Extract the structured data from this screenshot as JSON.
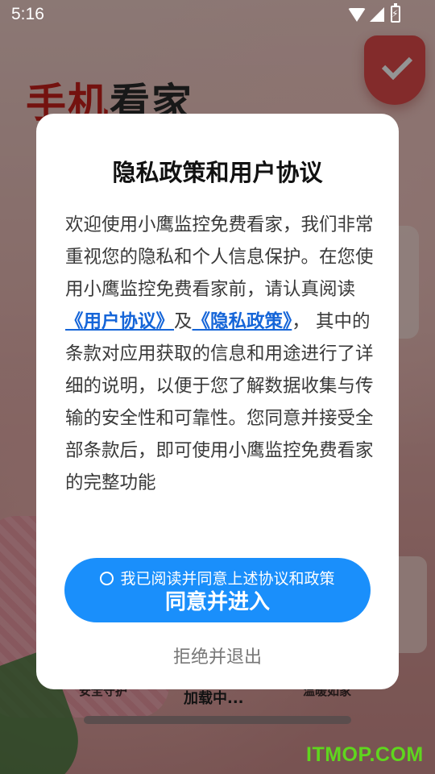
{
  "status_bar": {
    "time": "5:16",
    "icons": [
      "wifi-icon",
      "signal-icon",
      "battery-charging-icon"
    ]
  },
  "background": {
    "heading_red": "手机",
    "heading_dark": "看家",
    "bottom_labels": [
      "安全守护",
      "加载中...",
      "温暖如家"
    ],
    "shield_icon": "shield-check-icon"
  },
  "dialog": {
    "title": "隐私政策和用户协议",
    "body_intro": "欢迎使用小鹰监控免费看家，我们非常重视您的隐私和个人信息保护。在您使用小鹰监控免费看家前，请认真阅读",
    "user_agreement_link": "《用户协议》",
    "and_text": "及",
    "privacy_policy_link": "《隐私政策》",
    "body_rest": "， 其中的条款对应用获取的信息和用途进行了详细的说明，以便于您了解数据收集与传输的安全性和可靠性。您同意并接受全部条款后，即可使用小鹰监控免费看家的完整功能",
    "checkbox_label": "我已阅读并同意上述协议和政策",
    "checkbox_checked": false,
    "agree_button": "同意并进入",
    "reject_button": "拒绝并退出"
  },
  "colors": {
    "accent": "#1a8ffb",
    "link": "#1565d8",
    "brand_red": "#c8201a"
  },
  "watermark": "ITMOP.COM"
}
